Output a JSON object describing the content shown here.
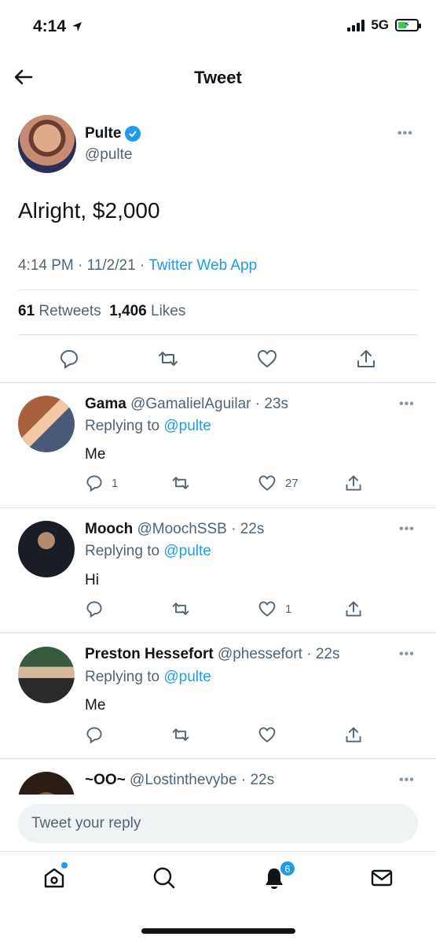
{
  "status_bar": {
    "time": "4:14",
    "network": "5G"
  },
  "header": {
    "title": "Tweet"
  },
  "tweet": {
    "author_name": "Pulte",
    "author_handle": "@pulte",
    "text": "Alright, $2,000",
    "time": "4:14 PM",
    "date": "11/2/21",
    "source": "Twitter Web App",
    "retweets_count": "61",
    "retweets_label": "Retweets",
    "likes_count": "1,406",
    "likes_label": "Likes"
  },
  "replies": [
    {
      "name": "Gama",
      "handle": "@GamalielAguilar",
      "time": "23s",
      "replying_label": "Replying to",
      "replying_to": "@pulte",
      "text": "Me",
      "reply_count": "1",
      "retweet_count": "",
      "like_count": "27"
    },
    {
      "name": "Mooch",
      "handle": "@MoochSSB",
      "time": "22s",
      "replying_label": "Replying to",
      "replying_to": "@pulte",
      "text": "Hi",
      "reply_count": "",
      "retweet_count": "",
      "like_count": "1"
    },
    {
      "name": "Preston Hessefort",
      "handle": "@phessefort",
      "time": "22s",
      "replying_label": "Replying to",
      "replying_to": "@pulte",
      "text": "Me",
      "reply_count": "",
      "retweet_count": "",
      "like_count": ""
    },
    {
      "name": "~OO~",
      "handle": "@Lostinthevybe",
      "time": "22s"
    }
  ],
  "reply_box": {
    "placeholder": "Tweet your reply"
  },
  "tabbar": {
    "notifications_badge": "6"
  },
  "colors": {
    "accent": "#1d9bf0",
    "text": "#0f1419",
    "muted": "#536471"
  }
}
